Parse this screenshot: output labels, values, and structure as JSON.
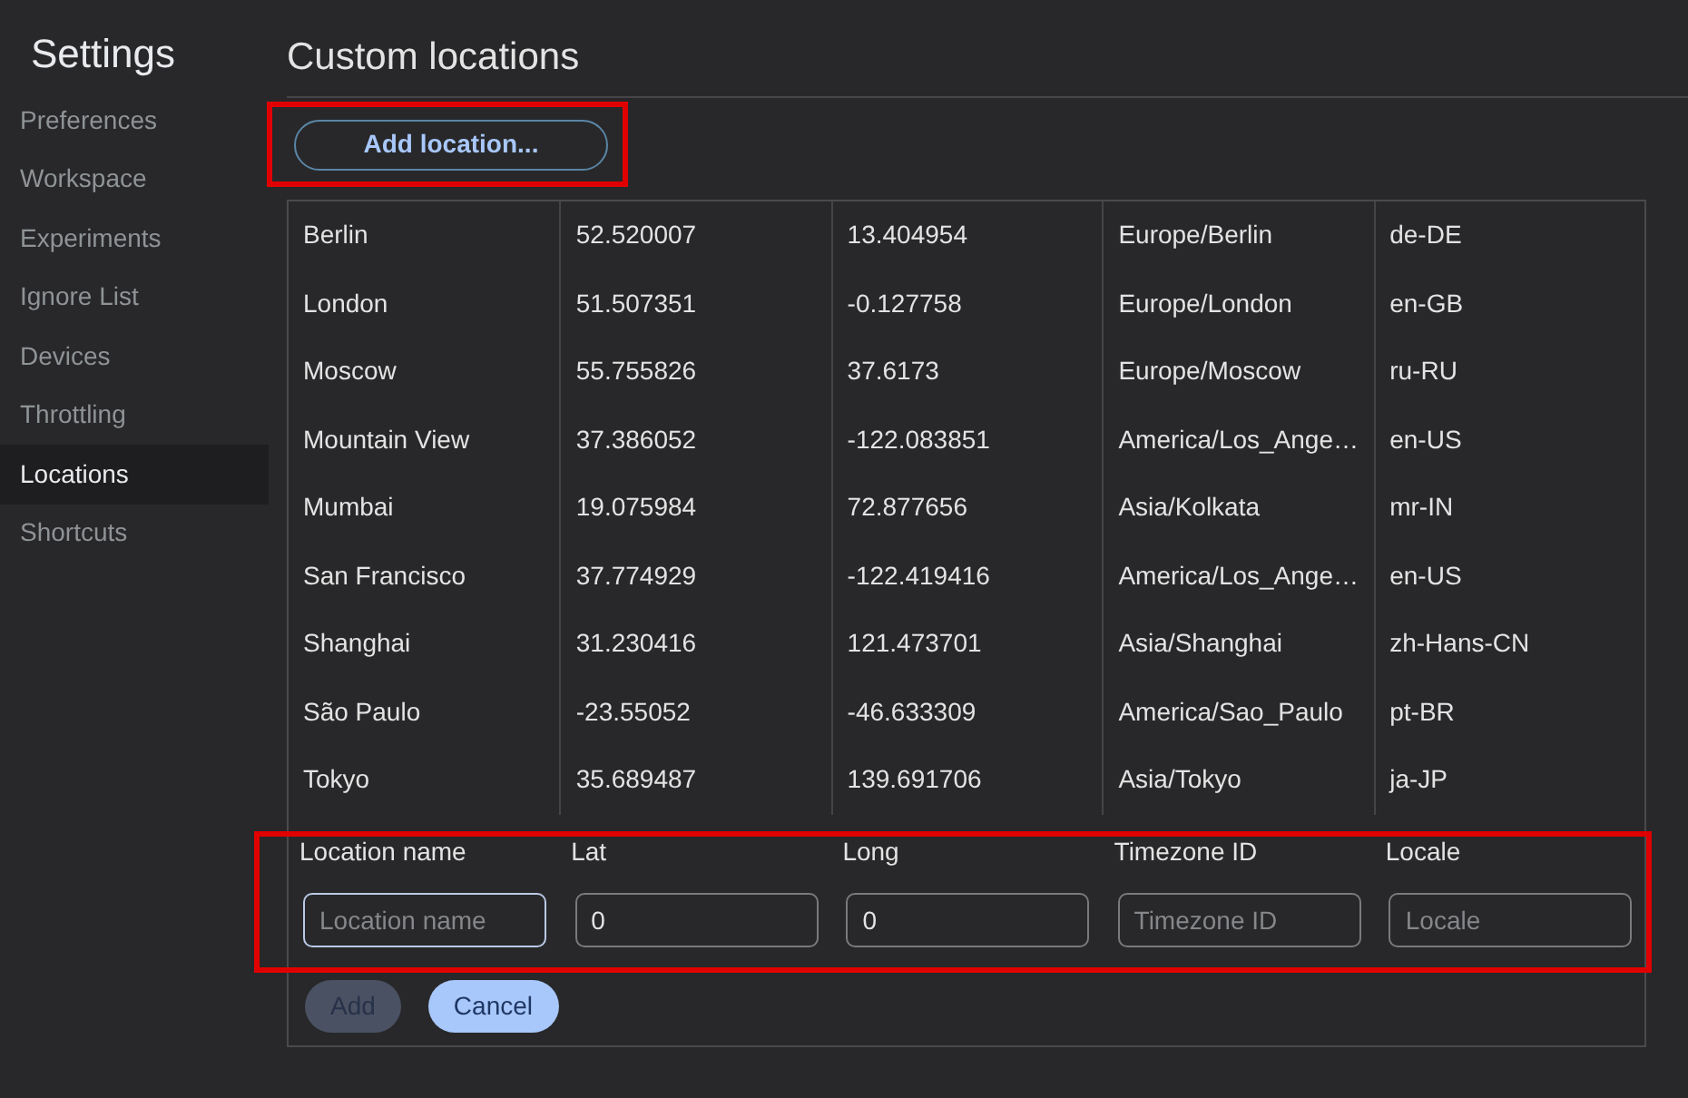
{
  "sidebar": {
    "title": "Settings",
    "items": [
      {
        "label": "Preferences",
        "selected": false
      },
      {
        "label": "Workspace",
        "selected": false
      },
      {
        "label": "Experiments",
        "selected": false
      },
      {
        "label": "Ignore List",
        "selected": false
      },
      {
        "label": "Devices",
        "selected": false
      },
      {
        "label": "Throttling",
        "selected": false
      },
      {
        "label": "Locations",
        "selected": true
      },
      {
        "label": "Shortcuts",
        "selected": false
      }
    ]
  },
  "page": {
    "title": "Custom locations"
  },
  "add_button": {
    "label": "Add location...",
    "highlighted": true
  },
  "table": {
    "rows": [
      {
        "cells": [
          "Berlin",
          "52.520007",
          "13.404954",
          "Europe/Berlin",
          "de-DE"
        ]
      },
      {
        "cells": [
          "London",
          "51.507351",
          "-0.127758",
          "Europe/London",
          "en-GB"
        ]
      },
      {
        "cells": [
          "Moscow",
          "55.755826",
          "37.6173",
          "Europe/Moscow",
          "ru-RU"
        ]
      },
      {
        "cells": [
          "Mountain View",
          "37.386052",
          "-122.083851",
          "America/Los_Ange…",
          "en-US"
        ]
      },
      {
        "cells": [
          "Mumbai",
          "19.075984",
          "72.877656",
          "Asia/Kolkata",
          "mr-IN"
        ]
      },
      {
        "cells": [
          "San Francisco",
          "37.774929",
          "-122.419416",
          "America/Los_Ange…",
          "en-US"
        ]
      },
      {
        "cells": [
          "Shanghai",
          "31.230416",
          "121.473701",
          "Asia/Shanghai",
          "zh-Hans-CN"
        ]
      },
      {
        "cells": [
          "São Paulo",
          "-23.55052",
          "-46.633309",
          "America/Sao_Paulo",
          "pt-BR"
        ]
      },
      {
        "cells": [
          "Tokyo",
          "35.689487",
          "139.691706",
          "Asia/Tokyo",
          "ja-JP"
        ]
      }
    ]
  },
  "form": {
    "highlighted": true,
    "fields": [
      {
        "label": "Location name",
        "placeholder": "Location name",
        "focused": true
      },
      {
        "label": "Lat",
        "value": "0",
        "focused": false
      },
      {
        "label": "Long",
        "value": "0",
        "focused": false
      },
      {
        "label": "Timezone ID",
        "placeholder": "Timezone ID",
        "focused": false
      },
      {
        "label": "Locale",
        "placeholder": "Locale",
        "focused": false
      }
    ],
    "buttons": [
      {
        "label": "Add",
        "disabled": true
      },
      {
        "label": "Cancel",
        "disabled": false
      }
    ]
  }
}
